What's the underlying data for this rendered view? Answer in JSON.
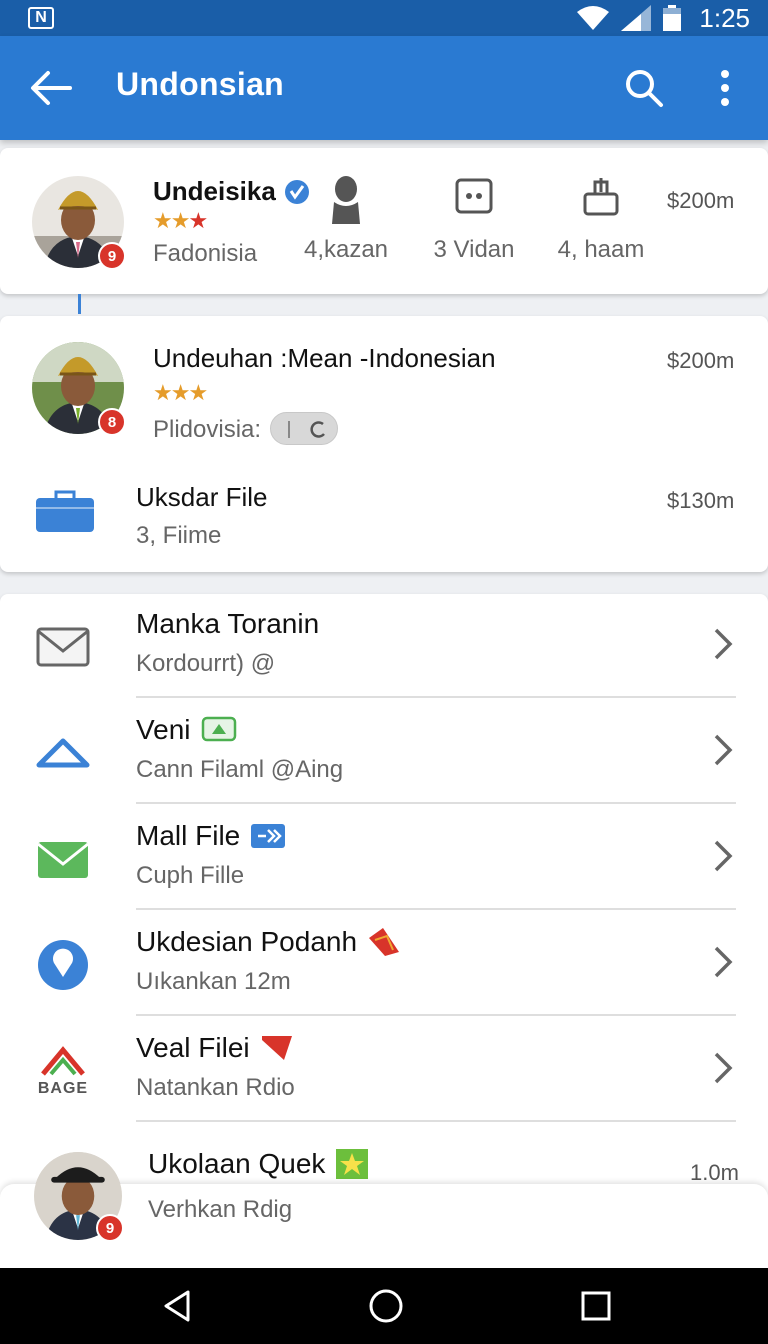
{
  "status_bar": {
    "time": "1:25",
    "left_icon": "nfc-icon"
  },
  "app_bar": {
    "title": "Undonsian"
  },
  "profile_card": {
    "name": "Undeisika",
    "location": "Fadonisia",
    "price": "$200m",
    "badge": "9",
    "stats": [
      {
        "icon": "person-icon",
        "label": "4,kazan"
      },
      {
        "icon": "video-icon",
        "label": "3 Vidan"
      },
      {
        "icon": "share-icon",
        "label": "4, haam"
      }
    ]
  },
  "second_card": {
    "item1": {
      "name": "Undeuhan :Mean -Indonesian",
      "status_label": "Plidovisia:",
      "price": "$200m",
      "badge": "8"
    },
    "item2": {
      "name": "Uksdar File",
      "sub": "3, Fiime",
      "price": "$130m"
    }
  },
  "list": [
    {
      "icon": "mail-icon",
      "title": "Manka Toranin",
      "sub": "Kordourrt) @"
    },
    {
      "icon": "triangle-icon",
      "title": "Veni",
      "sub": "Cann Filaml @Aing",
      "tag_icon": "recycle-tag-icon"
    },
    {
      "icon": "green-mail-icon",
      "title": "Mall File",
      "sub": "Cuph Fille",
      "tag_icon": "forward-tag-icon"
    },
    {
      "icon": "location-pin-icon",
      "title": "Ukdesian Podanh",
      "sub": "Uıkankan 12m",
      "tag_icon": "red-flag-icon"
    },
    {
      "icon": "bage-logo-icon",
      "title": "Veal Filei",
      "sub": "Natankan Rdio",
      "logo_text": "BAGE",
      "tag_icon": "red-envelope-icon"
    }
  ],
  "last_item": {
    "name": "Ukolaan Quek",
    "sub": "Verhkan Rdig",
    "price": "1.0m",
    "badge": "9"
  },
  "colors": {
    "app_bar": "#2a7ad2",
    "status_bar": "#1a5ea8",
    "accent_blue": "#3b82d6",
    "badge_red": "#d8342a"
  }
}
